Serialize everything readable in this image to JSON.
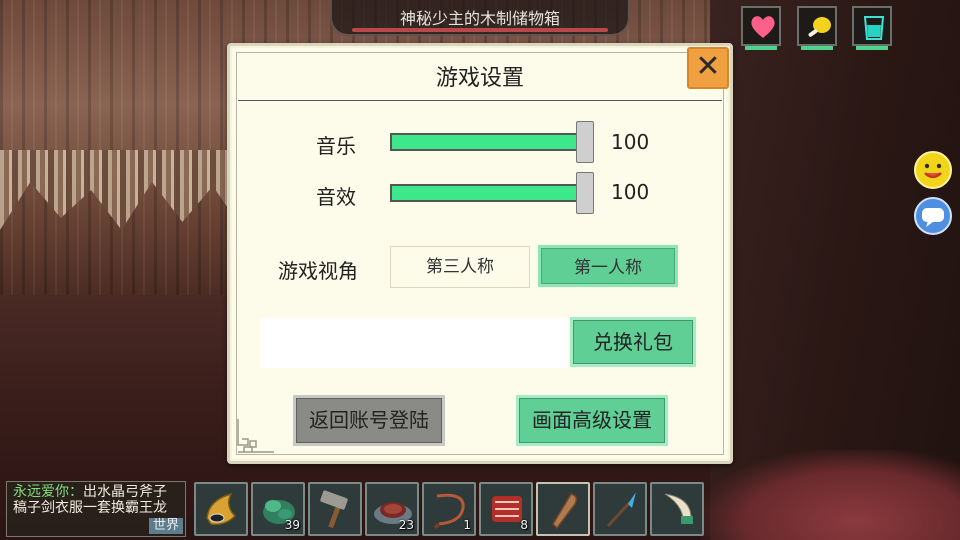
{
  "top_item": {
    "name": "神秘少主的木制储物箱"
  },
  "status_icons": [
    "heart-icon",
    "meat-icon",
    "water-glass-icon"
  ],
  "side_buttons": [
    "emoji-icon",
    "chat-bubble-icon"
  ],
  "settings": {
    "title": "游戏设置",
    "close_label": "✕",
    "music": {
      "label": "音乐",
      "value": 100,
      "max": 100
    },
    "sfx": {
      "label": "音效",
      "value": 100,
      "max": 100
    },
    "view": {
      "label": "游戏视角",
      "options": [
        "第三人称",
        "第一人称"
      ],
      "selected": "第一人称"
    },
    "gift": {
      "input_value": "",
      "button_label": "兑换礼包"
    },
    "back_button": "返回账号登陆",
    "advanced_button": "画面高级设置"
  },
  "chat": {
    "nick": "永远爱你：",
    "message": "出水晶弓斧子稿子剑衣服一套换霸王龙",
    "channel": "世界"
  },
  "hotbar": [
    {
      "icon": "horn-icon",
      "count": ""
    },
    {
      "icon": "green-plant-icon",
      "count": "39"
    },
    {
      "icon": "stone-hammer-icon",
      "count": ""
    },
    {
      "icon": "steak-plate-icon",
      "count": "23"
    },
    {
      "icon": "rope-whip-icon",
      "count": "1"
    },
    {
      "icon": "raw-meat-icon",
      "count": "8"
    },
    {
      "icon": "wooden-club-icon",
      "count": ""
    },
    {
      "icon": "crystal-spear-icon",
      "count": ""
    },
    {
      "icon": "bone-knife-icon",
      "count": ""
    }
  ],
  "colors": {
    "slider_fill": "#3de88a",
    "selected_button": "#5fcf95",
    "close_button": "#f0a040",
    "panel": "#fdfbe9"
  }
}
